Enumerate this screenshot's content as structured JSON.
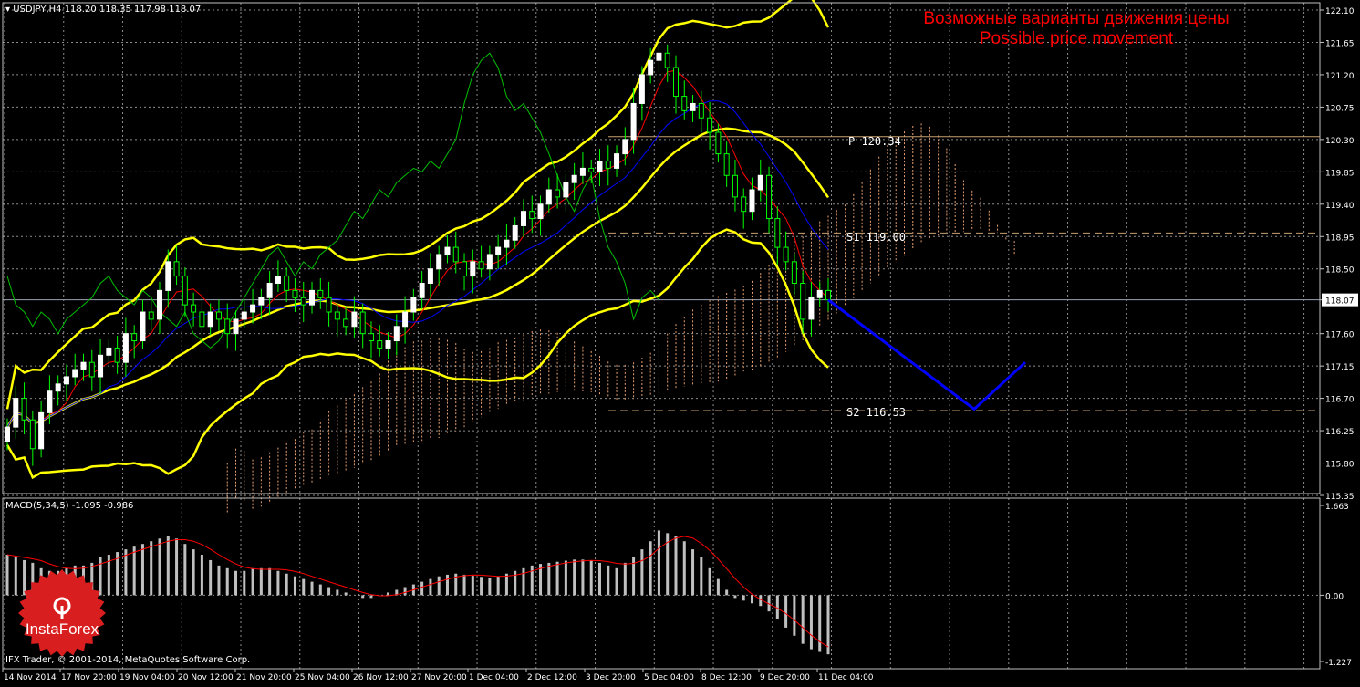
{
  "header": {
    "symbol_line": "USDJPY,H4  118.20 118.35 117.98 118.07"
  },
  "overlay_title": {
    "line1": "Возможные варианты движения цены",
    "line2": "Possible price movement"
  },
  "levels": {
    "p_label": "P  120.34",
    "s1_label": "S1  119.00",
    "s2_label": "S2  116.53"
  },
  "macd": {
    "header": "MACD(5,34,5) -1.095 -0.986",
    "scale_top": "1.663",
    "scale_mid": "0.00",
    "scale_bot": "-1.227"
  },
  "footer": {
    "copyright": "IFX Trader, © 2001-2014, MetaQuotes Software Corp."
  },
  "logo": {
    "text": "InstaForex"
  },
  "colors": {
    "bg": "#000000",
    "grid": "#8c8c8c",
    "candle_up": "#ffffff",
    "candle_down": "#00ff00",
    "bands": "#ffff00",
    "red_line": "#ff0000",
    "blue_line": "#0000ff",
    "green_line": "#00c000",
    "forecast": "#0000ff",
    "logo": "#d81e1e"
  },
  "chart_data": {
    "type": "candlestick",
    "symbol": "USDJPY",
    "timeframe": "H4",
    "ohlc_header": {
      "open": 118.2,
      "high": 118.35,
      "low": 117.98,
      "close": 118.07
    },
    "current_price": "118.07",
    "y_ticks": [
      "122.10",
      "121.65",
      "121.20",
      "120.75",
      "120.30",
      "119.85",
      "119.40",
      "118.95",
      "118.50",
      "118.07",
      "117.60",
      "117.15",
      "116.70",
      "116.25",
      "115.80",
      "115.35"
    ],
    "ylim": [
      115.35,
      122.1
    ],
    "x_ticks": [
      "14 Nov 2014",
      "17 Nov 20:00",
      "19 Nov 04:00",
      "20 Nov 12:00",
      "21 Nov 20:00",
      "25 Nov 04:00",
      "26 Nov 12:00",
      "27 Nov 20:00",
      "1 Dec 04:00",
      "2 Dec 12:00",
      "3 Dec 20:00",
      "5 Dec 04:00",
      "8 Dec 12:00",
      "9 Dec 20:00",
      "11 Dec 04:00"
    ],
    "levels": [
      {
        "name": "P",
        "value": 120.34
      },
      {
        "name": "S1",
        "value": 119.0
      },
      {
        "name": "S2",
        "value": 116.53
      }
    ],
    "forecast_path": [
      118.07,
      116.55,
      117.2
    ],
    "closes": [
      116.3,
      116.7,
      116.4,
      116.0,
      116.5,
      116.8,
      116.9,
      117.0,
      117.1,
      117.2,
      117.0,
      117.3,
      117.4,
      117.2,
      117.6,
      117.5,
      117.9,
      117.8,
      118.2,
      118.6,
      118.4,
      118.0,
      117.9,
      117.7,
      117.9,
      117.8,
      117.6,
      117.8,
      117.9,
      118.0,
      118.1,
      118.3,
      118.4,
      118.2,
      118.1,
      118.0,
      118.2,
      118.1,
      117.9,
      117.8,
      117.7,
      117.9,
      117.6,
      117.5,
      117.4,
      117.5,
      117.7,
      117.9,
      118.1,
      118.3,
      118.5,
      118.7,
      118.8,
      118.6,
      118.4,
      118.6,
      118.5,
      118.7,
      118.8,
      118.9,
      119.1,
      119.3,
      119.2,
      119.4,
      119.6,
      119.5,
      119.7,
      119.8,
      119.9,
      119.85,
      120.0,
      119.9,
      120.1,
      120.3,
      120.8,
      121.2,
      121.4,
      121.5,
      121.3,
      120.9,
      120.7,
      120.8,
      120.6,
      120.4,
      120.1,
      119.8,
      119.5,
      119.3,
      119.6,
      119.8,
      119.2,
      118.8,
      118.6,
      118.3,
      117.8,
      118.1,
      118.2,
      118.07
    ],
    "macd_values": [
      0.75,
      0.7,
      0.65,
      0.6,
      0.5,
      0.45,
      0.45,
      0.5,
      0.55,
      0.55,
      0.6,
      0.7,
      0.75,
      0.8,
      0.85,
      0.9,
      0.95,
      1.0,
      1.05,
      1.1,
      1.05,
      0.95,
      0.85,
      0.75,
      0.65,
      0.55,
      0.5,
      0.45,
      0.45,
      0.5,
      0.5,
      0.5,
      0.45,
      0.4,
      0.35,
      0.3,
      0.25,
      0.2,
      0.15,
      0.1,
      0.05,
      0.0,
      -0.05,
      -0.05,
      0.0,
      0.05,
      0.1,
      0.15,
      0.2,
      0.25,
      0.3,
      0.35,
      0.38,
      0.4,
      0.38,
      0.36,
      0.34,
      0.32,
      0.35,
      0.4,
      0.45,
      0.5,
      0.55,
      0.58,
      0.6,
      0.62,
      0.64,
      0.66,
      0.66,
      0.64,
      0.6,
      0.55,
      0.5,
      0.6,
      0.7,
      0.85,
      1.0,
      1.2,
      1.15,
      1.1,
      1.0,
      0.85,
      0.7,
      0.5,
      0.3,
      0.1,
      -0.05,
      -0.1,
      -0.15,
      -0.2,
      -0.3,
      -0.45,
      -0.6,
      -0.75,
      -0.9,
      -1.0,
      -1.05,
      -1.095
    ],
    "macd_signal_note": "red signal line",
    "macd_ylim": [
      -1.227,
      1.663
    ]
  }
}
